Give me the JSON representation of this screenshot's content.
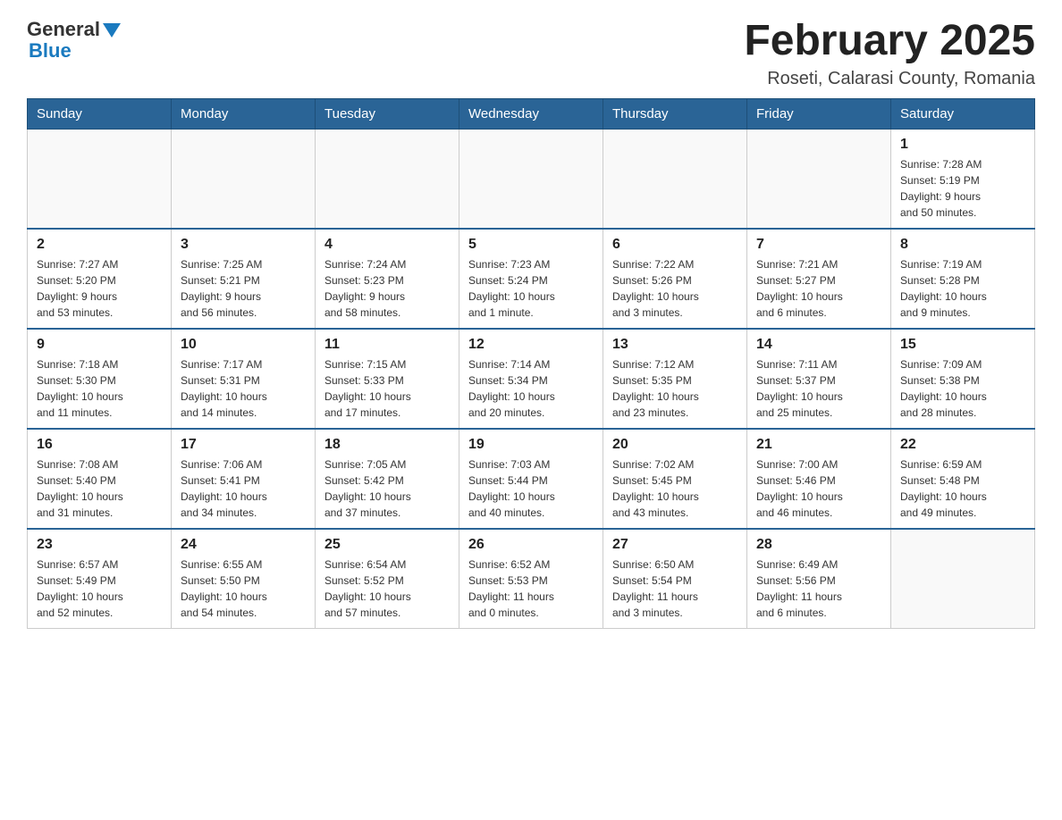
{
  "header": {
    "logo_general": "General",
    "logo_blue": "Blue",
    "title": "February 2025",
    "subtitle": "Roseti, Calarasi County, Romania"
  },
  "weekdays": [
    "Sunday",
    "Monday",
    "Tuesday",
    "Wednesday",
    "Thursday",
    "Friday",
    "Saturday"
  ],
  "weeks": [
    [
      {
        "day": "",
        "info": ""
      },
      {
        "day": "",
        "info": ""
      },
      {
        "day": "",
        "info": ""
      },
      {
        "day": "",
        "info": ""
      },
      {
        "day": "",
        "info": ""
      },
      {
        "day": "",
        "info": ""
      },
      {
        "day": "1",
        "info": "Sunrise: 7:28 AM\nSunset: 5:19 PM\nDaylight: 9 hours\nand 50 minutes."
      }
    ],
    [
      {
        "day": "2",
        "info": "Sunrise: 7:27 AM\nSunset: 5:20 PM\nDaylight: 9 hours\nand 53 minutes."
      },
      {
        "day": "3",
        "info": "Sunrise: 7:25 AM\nSunset: 5:21 PM\nDaylight: 9 hours\nand 56 minutes."
      },
      {
        "day": "4",
        "info": "Sunrise: 7:24 AM\nSunset: 5:23 PM\nDaylight: 9 hours\nand 58 minutes."
      },
      {
        "day": "5",
        "info": "Sunrise: 7:23 AM\nSunset: 5:24 PM\nDaylight: 10 hours\nand 1 minute."
      },
      {
        "day": "6",
        "info": "Sunrise: 7:22 AM\nSunset: 5:26 PM\nDaylight: 10 hours\nand 3 minutes."
      },
      {
        "day": "7",
        "info": "Sunrise: 7:21 AM\nSunset: 5:27 PM\nDaylight: 10 hours\nand 6 minutes."
      },
      {
        "day": "8",
        "info": "Sunrise: 7:19 AM\nSunset: 5:28 PM\nDaylight: 10 hours\nand 9 minutes."
      }
    ],
    [
      {
        "day": "9",
        "info": "Sunrise: 7:18 AM\nSunset: 5:30 PM\nDaylight: 10 hours\nand 11 minutes."
      },
      {
        "day": "10",
        "info": "Sunrise: 7:17 AM\nSunset: 5:31 PM\nDaylight: 10 hours\nand 14 minutes."
      },
      {
        "day": "11",
        "info": "Sunrise: 7:15 AM\nSunset: 5:33 PM\nDaylight: 10 hours\nand 17 minutes."
      },
      {
        "day": "12",
        "info": "Sunrise: 7:14 AM\nSunset: 5:34 PM\nDaylight: 10 hours\nand 20 minutes."
      },
      {
        "day": "13",
        "info": "Sunrise: 7:12 AM\nSunset: 5:35 PM\nDaylight: 10 hours\nand 23 minutes."
      },
      {
        "day": "14",
        "info": "Sunrise: 7:11 AM\nSunset: 5:37 PM\nDaylight: 10 hours\nand 25 minutes."
      },
      {
        "day": "15",
        "info": "Sunrise: 7:09 AM\nSunset: 5:38 PM\nDaylight: 10 hours\nand 28 minutes."
      }
    ],
    [
      {
        "day": "16",
        "info": "Sunrise: 7:08 AM\nSunset: 5:40 PM\nDaylight: 10 hours\nand 31 minutes."
      },
      {
        "day": "17",
        "info": "Sunrise: 7:06 AM\nSunset: 5:41 PM\nDaylight: 10 hours\nand 34 minutes."
      },
      {
        "day": "18",
        "info": "Sunrise: 7:05 AM\nSunset: 5:42 PM\nDaylight: 10 hours\nand 37 minutes."
      },
      {
        "day": "19",
        "info": "Sunrise: 7:03 AM\nSunset: 5:44 PM\nDaylight: 10 hours\nand 40 minutes."
      },
      {
        "day": "20",
        "info": "Sunrise: 7:02 AM\nSunset: 5:45 PM\nDaylight: 10 hours\nand 43 minutes."
      },
      {
        "day": "21",
        "info": "Sunrise: 7:00 AM\nSunset: 5:46 PM\nDaylight: 10 hours\nand 46 minutes."
      },
      {
        "day": "22",
        "info": "Sunrise: 6:59 AM\nSunset: 5:48 PM\nDaylight: 10 hours\nand 49 minutes."
      }
    ],
    [
      {
        "day": "23",
        "info": "Sunrise: 6:57 AM\nSunset: 5:49 PM\nDaylight: 10 hours\nand 52 minutes."
      },
      {
        "day": "24",
        "info": "Sunrise: 6:55 AM\nSunset: 5:50 PM\nDaylight: 10 hours\nand 54 minutes."
      },
      {
        "day": "25",
        "info": "Sunrise: 6:54 AM\nSunset: 5:52 PM\nDaylight: 10 hours\nand 57 minutes."
      },
      {
        "day": "26",
        "info": "Sunrise: 6:52 AM\nSunset: 5:53 PM\nDaylight: 11 hours\nand 0 minutes."
      },
      {
        "day": "27",
        "info": "Sunrise: 6:50 AM\nSunset: 5:54 PM\nDaylight: 11 hours\nand 3 minutes."
      },
      {
        "day": "28",
        "info": "Sunrise: 6:49 AM\nSunset: 5:56 PM\nDaylight: 11 hours\nand 6 minutes."
      },
      {
        "day": "",
        "info": ""
      }
    ]
  ]
}
